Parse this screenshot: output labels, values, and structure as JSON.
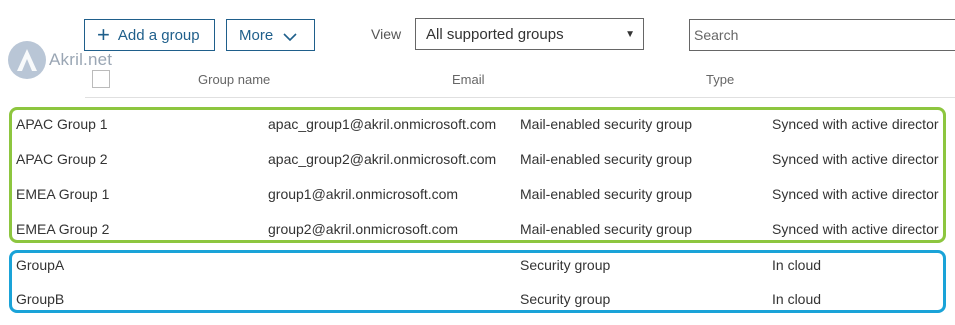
{
  "toolbar": {
    "add_group_label": "Add a group",
    "more_label": "More",
    "view_label": "View",
    "view_selected": "All supported groups",
    "search_placeholder": "Search"
  },
  "watermark": {
    "text": "Akril.net",
    "letter": "A"
  },
  "columns": {
    "name": "Group name",
    "email": "Email",
    "type": "Type"
  },
  "rows": [
    {
      "name": "APAC Group 1",
      "email": "apac_group1@akril.onmicrosoft.com",
      "type": "Mail-enabled security group",
      "status": "Synced with active director"
    },
    {
      "name": "APAC Group 2",
      "email": "apac_group2@akril.onmicrosoft.com",
      "type": "Mail-enabled security group",
      "status": "Synced with active director"
    },
    {
      "name": "EMEA Group 1",
      "email": "group1@akril.onmicrosoft.com",
      "type": "Mail-enabled security group",
      "status": "Synced with active director"
    },
    {
      "name": "EMEA Group 2",
      "email": "group2@akril.onmicrosoft.com",
      "type": "Mail-enabled security group",
      "status": "Synced with active director"
    },
    {
      "name": "GroupA",
      "email": "",
      "type": "Security group",
      "status": "In cloud"
    },
    {
      "name": "GroupB",
      "email": "",
      "type": "Security group",
      "status": "In cloud"
    }
  ],
  "colors": {
    "accent": "#1f5f8b",
    "synced_frame": "#8dc63f",
    "cloud_frame": "#1aa3d8"
  }
}
